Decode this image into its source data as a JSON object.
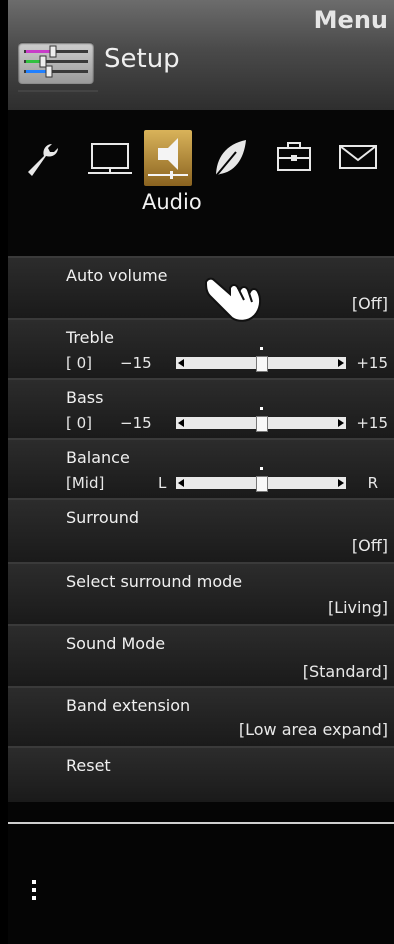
{
  "header": {
    "title": "Menu",
    "section": "Setup"
  },
  "tabs": {
    "items": [
      {
        "icon": "wrench-icon"
      },
      {
        "icon": "monitor-icon"
      },
      {
        "icon": "speaker-icon"
      },
      {
        "icon": "leaf-icon"
      },
      {
        "icon": "briefcase-icon"
      },
      {
        "icon": "mail-icon"
      }
    ],
    "active_caption": "Audio"
  },
  "settings": {
    "auto_volume": {
      "label": "Auto volume",
      "value": "[Off]"
    },
    "treble": {
      "label": "Treble",
      "current": "[   0]",
      "min": "−15",
      "max": "+15",
      "level": 0
    },
    "bass": {
      "label": "Bass",
      "current": "[   0]",
      "min": "−15",
      "max": "+15",
      "level": 0
    },
    "balance": {
      "label": "Balance",
      "current": "[Mid]",
      "min": "L",
      "max": "R",
      "level": 0
    },
    "surround": {
      "label": "Surround",
      "value": "[Off]"
    },
    "surround_mode": {
      "label": "Select surround mode",
      "value": "[Living]"
    },
    "sound_mode": {
      "label": "Sound Mode",
      "value": "[Standard]"
    },
    "band_extension": {
      "label": "Band extension",
      "value": "[Low area expand]"
    },
    "reset": {
      "label": "Reset"
    }
  },
  "colors": {
    "accent_tab": "#c79a3f",
    "row_bg": "#222222"
  }
}
